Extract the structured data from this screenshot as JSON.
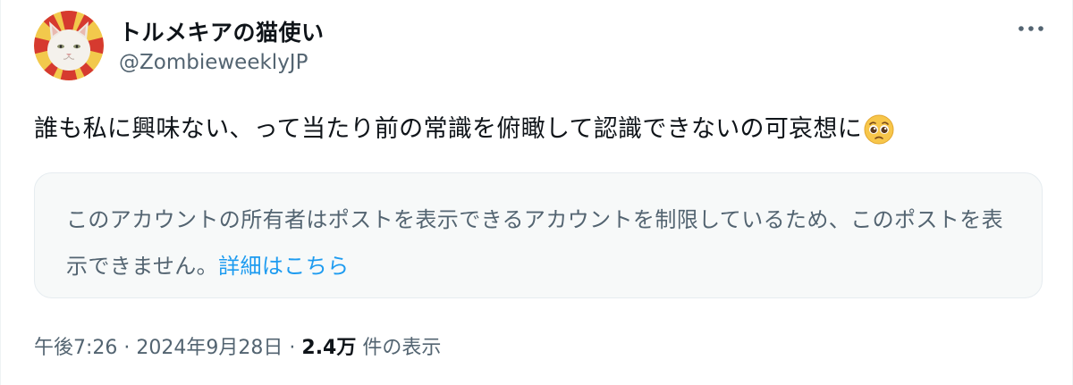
{
  "author": {
    "display_name": "トルメキアの猫使い",
    "handle": "@ZombieweeklyJP",
    "avatar_icon": "white-cat-avatar"
  },
  "more_icon": "more-horizontal-icon",
  "tweet": {
    "text": "誰も私に興味ない、って当たり前の常識を俯瞰して認識できないの可哀想に",
    "emoji": "pleading-face-emoji"
  },
  "notice": {
    "text": "このアカウントの所有者はポストを表示できるアカウントを制限しているため、このポストを表示できません。",
    "link": "詳細はこちら"
  },
  "meta": {
    "time": "午後7:26",
    "separator": "·",
    "date": "2024年9月28日",
    "views_count": "2.4万",
    "views_label": "件の表示"
  },
  "colors": {
    "text_primary": "#0f1419",
    "text_secondary": "#536471",
    "link": "#1d9bf0",
    "notice_bg": "#f7f9f9",
    "notice_border": "#e6ecf0"
  }
}
